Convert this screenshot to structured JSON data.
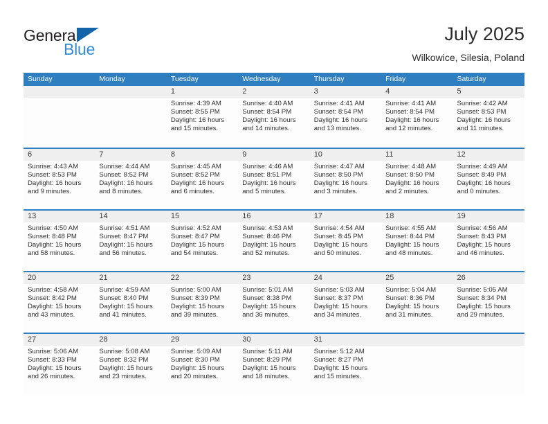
{
  "brand": {
    "name_dark": "General",
    "name_blue": "Blue",
    "triangle_icon": "triangle-logo-icon",
    "color_dark": "#231f20",
    "color_blue": "#2e8bd4",
    "color_triangle": "#1464aa"
  },
  "header": {
    "title": "July 2025",
    "subtitle": "Wilkowice, Silesia, Poland"
  },
  "theme": {
    "header_blue": "#2f7ec0",
    "date_band_gray": "#efefef",
    "cell_bg": "#fdfdfd",
    "text": "#2e2e2e"
  },
  "weekdays": [
    "Sunday",
    "Monday",
    "Tuesday",
    "Wednesday",
    "Thursday",
    "Friday",
    "Saturday"
  ],
  "weeks": [
    [
      {
        "date": "",
        "lines": []
      },
      {
        "date": "",
        "lines": []
      },
      {
        "date": "1",
        "lines": [
          "Sunrise: 4:39 AM",
          "Sunset: 8:55 PM",
          "Daylight: 16 hours",
          "and 15 minutes."
        ]
      },
      {
        "date": "2",
        "lines": [
          "Sunrise: 4:40 AM",
          "Sunset: 8:54 PM",
          "Daylight: 16 hours",
          "and 14 minutes."
        ]
      },
      {
        "date": "3",
        "lines": [
          "Sunrise: 4:41 AM",
          "Sunset: 8:54 PM",
          "Daylight: 16 hours",
          "and 13 minutes."
        ]
      },
      {
        "date": "4",
        "lines": [
          "Sunrise: 4:41 AM",
          "Sunset: 8:54 PM",
          "Daylight: 16 hours",
          "and 12 minutes."
        ]
      },
      {
        "date": "5",
        "lines": [
          "Sunrise: 4:42 AM",
          "Sunset: 8:53 PM",
          "Daylight: 16 hours",
          "and 11 minutes."
        ]
      }
    ],
    [
      {
        "date": "6",
        "lines": [
          "Sunrise: 4:43 AM",
          "Sunset: 8:53 PM",
          "Daylight: 16 hours",
          "and 9 minutes."
        ]
      },
      {
        "date": "7",
        "lines": [
          "Sunrise: 4:44 AM",
          "Sunset: 8:52 PM",
          "Daylight: 16 hours",
          "and 8 minutes."
        ]
      },
      {
        "date": "8",
        "lines": [
          "Sunrise: 4:45 AM",
          "Sunset: 8:52 PM",
          "Daylight: 16 hours",
          "and 6 minutes."
        ]
      },
      {
        "date": "9",
        "lines": [
          "Sunrise: 4:46 AM",
          "Sunset: 8:51 PM",
          "Daylight: 16 hours",
          "and 5 minutes."
        ]
      },
      {
        "date": "10",
        "lines": [
          "Sunrise: 4:47 AM",
          "Sunset: 8:50 PM",
          "Daylight: 16 hours",
          "and 3 minutes."
        ]
      },
      {
        "date": "11",
        "lines": [
          "Sunrise: 4:48 AM",
          "Sunset: 8:50 PM",
          "Daylight: 16 hours",
          "and 2 minutes."
        ]
      },
      {
        "date": "12",
        "lines": [
          "Sunrise: 4:49 AM",
          "Sunset: 8:49 PM",
          "Daylight: 16 hours",
          "and 0 minutes."
        ]
      }
    ],
    [
      {
        "date": "13",
        "lines": [
          "Sunrise: 4:50 AM",
          "Sunset: 8:48 PM",
          "Daylight: 15 hours",
          "and 58 minutes."
        ]
      },
      {
        "date": "14",
        "lines": [
          "Sunrise: 4:51 AM",
          "Sunset: 8:47 PM",
          "Daylight: 15 hours",
          "and 56 minutes."
        ]
      },
      {
        "date": "15",
        "lines": [
          "Sunrise: 4:52 AM",
          "Sunset: 8:47 PM",
          "Daylight: 15 hours",
          "and 54 minutes."
        ]
      },
      {
        "date": "16",
        "lines": [
          "Sunrise: 4:53 AM",
          "Sunset: 8:46 PM",
          "Daylight: 15 hours",
          "and 52 minutes."
        ]
      },
      {
        "date": "17",
        "lines": [
          "Sunrise: 4:54 AM",
          "Sunset: 8:45 PM",
          "Daylight: 15 hours",
          "and 50 minutes."
        ]
      },
      {
        "date": "18",
        "lines": [
          "Sunrise: 4:55 AM",
          "Sunset: 8:44 PM",
          "Daylight: 15 hours",
          "and 48 minutes."
        ]
      },
      {
        "date": "19",
        "lines": [
          "Sunrise: 4:56 AM",
          "Sunset: 8:43 PM",
          "Daylight: 15 hours",
          "and 46 minutes."
        ]
      }
    ],
    [
      {
        "date": "20",
        "lines": [
          "Sunrise: 4:58 AM",
          "Sunset: 8:42 PM",
          "Daylight: 15 hours",
          "and 43 minutes."
        ]
      },
      {
        "date": "21",
        "lines": [
          "Sunrise: 4:59 AM",
          "Sunset: 8:40 PM",
          "Daylight: 15 hours",
          "and 41 minutes."
        ]
      },
      {
        "date": "22",
        "lines": [
          "Sunrise: 5:00 AM",
          "Sunset: 8:39 PM",
          "Daylight: 15 hours",
          "and 39 minutes."
        ]
      },
      {
        "date": "23",
        "lines": [
          "Sunrise: 5:01 AM",
          "Sunset: 8:38 PM",
          "Daylight: 15 hours",
          "and 36 minutes."
        ]
      },
      {
        "date": "24",
        "lines": [
          "Sunrise: 5:03 AM",
          "Sunset: 8:37 PM",
          "Daylight: 15 hours",
          "and 34 minutes."
        ]
      },
      {
        "date": "25",
        "lines": [
          "Sunrise: 5:04 AM",
          "Sunset: 8:36 PM",
          "Daylight: 15 hours",
          "and 31 minutes."
        ]
      },
      {
        "date": "26",
        "lines": [
          "Sunrise: 5:05 AM",
          "Sunset: 8:34 PM",
          "Daylight: 15 hours",
          "and 29 minutes."
        ]
      }
    ],
    [
      {
        "date": "27",
        "lines": [
          "Sunrise: 5:06 AM",
          "Sunset: 8:33 PM",
          "Daylight: 15 hours",
          "and 26 minutes."
        ]
      },
      {
        "date": "28",
        "lines": [
          "Sunrise: 5:08 AM",
          "Sunset: 8:32 PM",
          "Daylight: 15 hours",
          "and 23 minutes."
        ]
      },
      {
        "date": "29",
        "lines": [
          "Sunrise: 5:09 AM",
          "Sunset: 8:30 PM",
          "Daylight: 15 hours",
          "and 20 minutes."
        ]
      },
      {
        "date": "30",
        "lines": [
          "Sunrise: 5:11 AM",
          "Sunset: 8:29 PM",
          "Daylight: 15 hours",
          "and 18 minutes."
        ]
      },
      {
        "date": "31",
        "lines": [
          "Sunrise: 5:12 AM",
          "Sunset: 8:27 PM",
          "Daylight: 15 hours",
          "and 15 minutes."
        ]
      },
      {
        "date": "",
        "lines": []
      },
      {
        "date": "",
        "lines": []
      }
    ]
  ]
}
